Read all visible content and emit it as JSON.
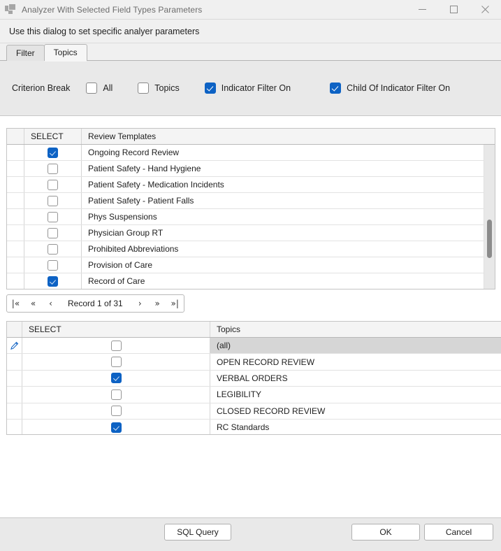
{
  "window": {
    "title": "Analyzer With Selected Field Types Parameters",
    "icon": "app-window-icon",
    "controls": {
      "minimize": "minimize-icon",
      "maximize": "maximize-icon",
      "close": "close-icon"
    }
  },
  "prompt": "Use this dialog to set specific analyer parameters",
  "tabs": [
    {
      "label": "Filter",
      "active": false
    },
    {
      "label": "Topics",
      "active": true
    }
  ],
  "criterion": {
    "label": "Criterion Break",
    "options": [
      {
        "label": "All",
        "checked": false
      },
      {
        "label": "Topics",
        "checked": false
      },
      {
        "label": "Indicator Filter On",
        "checked": true
      },
      {
        "label": "Child Of Indicator Filter On",
        "checked": true
      }
    ]
  },
  "templates_grid": {
    "columns": [
      "SELECT",
      "Review Templates"
    ],
    "rows": [
      {
        "select": true,
        "name": "Ongoing Record Review"
      },
      {
        "select": false,
        "name": "Patient Safety - Hand Hygiene"
      },
      {
        "select": false,
        "name": "Patient Safety - Medication Incidents"
      },
      {
        "select": false,
        "name": "Patient Safety - Patient Falls"
      },
      {
        "select": false,
        "name": "Phys Suspensions"
      },
      {
        "select": false,
        "name": "Physician Group RT"
      },
      {
        "select": false,
        "name": "Prohibited Abbreviations"
      },
      {
        "select": false,
        "name": "Provision of Care"
      },
      {
        "select": true,
        "name": "Record of Care"
      }
    ]
  },
  "navigator": {
    "first": "|«",
    "prev_page": "«",
    "prev": "‹",
    "status": "Record 1 of 31",
    "next": "›",
    "next_page": "»",
    "last": "»|"
  },
  "topics_grid": {
    "columns": [
      "SELECT",
      "Topics"
    ],
    "rows": [
      {
        "select": false,
        "name": "(all)",
        "current": true,
        "edit_icon": "pencil-icon"
      },
      {
        "select": false,
        "name": "OPEN RECORD REVIEW",
        "current": false,
        "edit_icon": ""
      },
      {
        "select": true,
        "name": "VERBAL ORDERS",
        "current": false,
        "edit_icon": ""
      },
      {
        "select": false,
        "name": "LEGIBILITY",
        "current": false,
        "edit_icon": ""
      },
      {
        "select": false,
        "name": "CLOSED RECORD REVIEW",
        "current": false,
        "edit_icon": ""
      },
      {
        "select": true,
        "name": "RC Standards",
        "current": false,
        "edit_icon": ""
      }
    ]
  },
  "footer": {
    "sql_query": "SQL Query",
    "ok": "OK",
    "cancel": "Cancel"
  },
  "colors": {
    "accent": "#0d62c4",
    "panel": "#e9e9e9",
    "chrome": "#f0f0f0",
    "border": "#c4c4c4",
    "selected_row": "#d6d6d6"
  }
}
